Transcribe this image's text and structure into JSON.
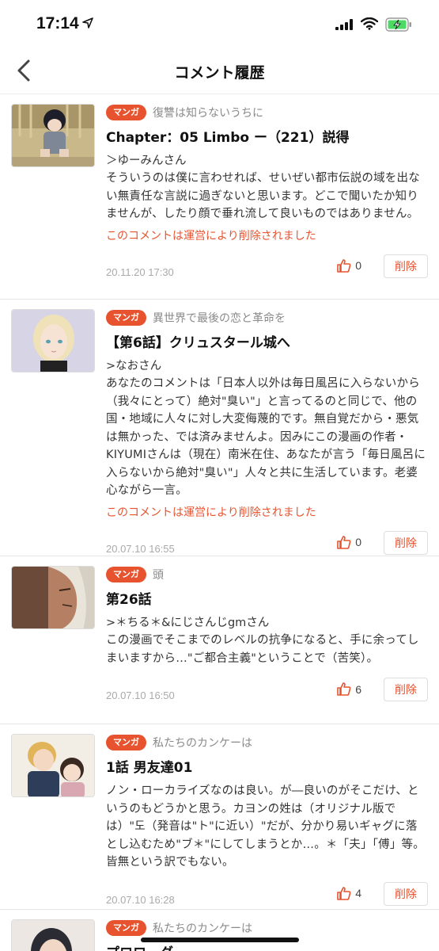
{
  "status_bar": {
    "time": "17:14"
  },
  "nav": {
    "title": "コメント履歴"
  },
  "items": [
    {
      "tag": "マンガ",
      "series": "復讐は知らないうちに",
      "episode": "Chapter：05 Limbo ー（221）説得",
      "reply_to": "＞ゆーみんさん",
      "body": "そういうのは僕に言わせれば、せいぜい都市伝説の域を出ない無責任な言説に過ぎないと思います。どこで聞いたか知りませんが、したり顔で垂れ流して良いものではありません。",
      "deleted_notice": "このコメントは運営により削除されました",
      "date": "20.11.20 17:30",
      "likes": "0",
      "delete_label": "削除"
    },
    {
      "tag": "マンガ",
      "series": "異世界で最後の恋と革命を",
      "episode": "【第6話】クリュスタール城へ",
      "reply_to": ">なおさん",
      "body": "あなたのコメントは「日本人以外は毎日風呂に入らないから（我々にとって）絶対\"臭い\"」と言ってるのと同じで、他の国・地域に人々に対し大変侮蔑的です。無自覚だから・悪気は無かった、では済みませんよ。因みにこの漫画の作者・KIYUMIさんは（現在）南米在住、あなたが言う「毎日風呂に入らないから絶対\"臭い\"」人々と共に生活しています。老婆心ながら一言。",
      "deleted_notice": "このコメントは運営により削除されました",
      "date": "20.07.10 16:55",
      "likes": "0",
      "delete_label": "削除"
    },
    {
      "tag": "マンガ",
      "series": "頭",
      "episode": "第26話",
      "reply_to": ">＊ちる＊&にじさんじgmさん",
      "body": "この漫画でそこまでのレベルの抗争になると、手に余ってしまいますから…\"ご都合主義\"ということで（苦笑）。",
      "deleted_notice": "",
      "date": "20.07.10 16:50",
      "likes": "6",
      "delete_label": "削除"
    },
    {
      "tag": "マンガ",
      "series": "私たちのカンケーは",
      "episode": "1話 男友達01",
      "reply_to": "",
      "body": "ノン・ローカライズなのは良い。が―良いのがそこだけ、というのもどうかと思う。カヨンの姓は（オリジナル版では）\"도（発音は\"ト\"に近い）\"だが、分かり易いギャグに落とし込むため\"ブ＊\"にしてしまうとか…。＊「夫」「傅」等。皆無という訳でもない。",
      "deleted_notice": "",
      "date": "20.07.10 16:28",
      "likes": "4",
      "delete_label": "削除"
    },
    {
      "tag": "マンガ",
      "series": "私たちのカンケーは",
      "episode": "プロローグ",
      "reply_to": "",
      "body": "",
      "deleted_notice": "",
      "date": "",
      "likes": "",
      "delete_label": ""
    }
  ]
}
